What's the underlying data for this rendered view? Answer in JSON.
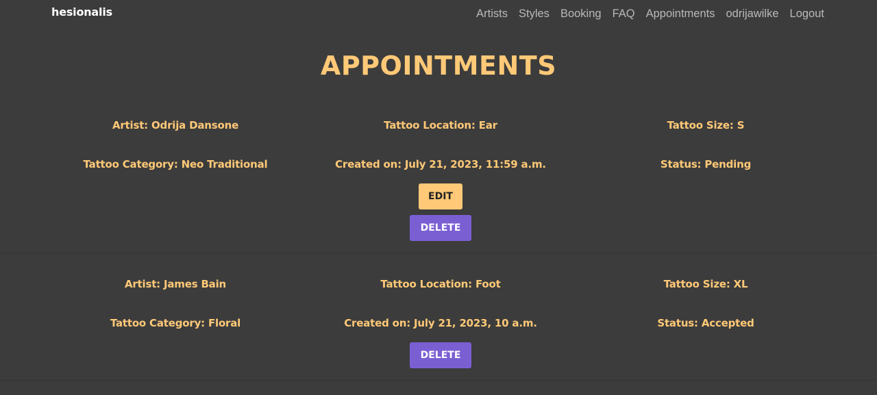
{
  "navbar": {
    "brand": "hesionalis",
    "links": [
      "Artists",
      "Styles",
      "Booking",
      "FAQ",
      "Appointments",
      "odrijawilke",
      "Logout"
    ]
  },
  "page": {
    "title": "APPOINTMENTS"
  },
  "appointments": [
    {
      "artist": "Artist: Odrija Dansone",
      "location": "Tattoo Location: Ear",
      "size": "Tattoo Size: S",
      "category": "Tattoo Category: Neo Traditional",
      "created": "Created on: July 21, 2023, 11:59 a.m.",
      "status": "Status: Pending",
      "edit_label": "EDIT",
      "delete_label": "DELETE"
    },
    {
      "artist": "Artist: James Bain",
      "location": "Tattoo Location: Foot",
      "size": "Tattoo Size: XL",
      "category": "Tattoo Category: Floral",
      "created": "Created on: July 21, 2023, 10 a.m.",
      "status": "Status: Accepted",
      "delete_label": "DELETE"
    }
  ],
  "colors": {
    "background": "#3c3c3c",
    "accent": "#ffc977",
    "delete": "#7a5fd3"
  }
}
